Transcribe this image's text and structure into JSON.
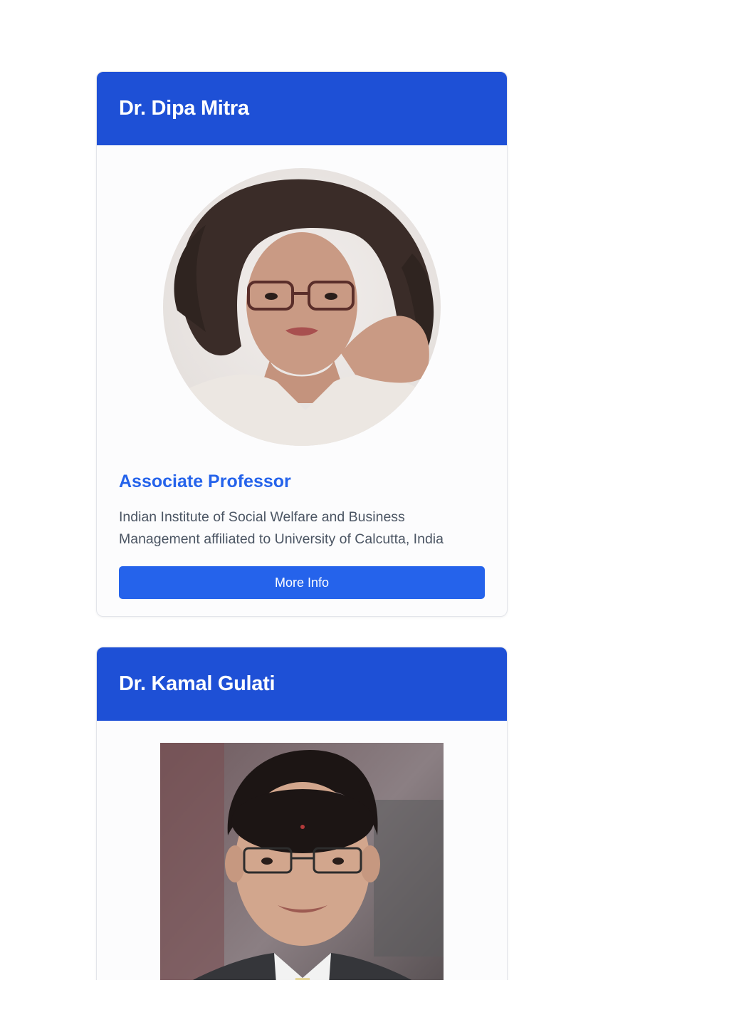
{
  "colors": {
    "header_bg": "#1e50d6",
    "accent": "#2563eb",
    "body_text": "#4b5563",
    "card_bg": "#fcfcfd"
  },
  "people": [
    {
      "name": "Dr. Dipa Mitra",
      "photo": "portrait-photo-woman",
      "role": "Associate Professor",
      "affiliation": "Indian Institute of Social Welfare and Business Management affiliated to University of Calcutta, India",
      "button_label": "More Info"
    },
    {
      "name": "Dr. Kamal Gulati",
      "photo": "portrait-photo-man"
    }
  ]
}
